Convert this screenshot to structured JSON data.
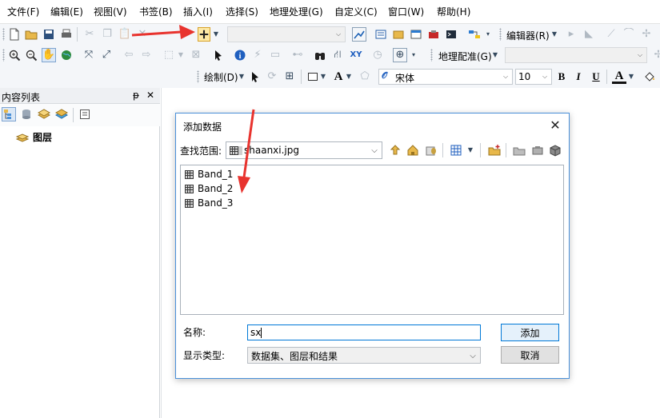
{
  "menu": [
    "文件(F)",
    "编辑(E)",
    "视图(V)",
    "书签(B)",
    "插入(I)",
    "选择(S)",
    "地理处理(G)",
    "自定义(C)",
    "窗口(W)",
    "帮助(H)"
  ],
  "toolbar": {
    "editor_label": "编辑器(R)",
    "georef_label": "地理配准(G)",
    "draw_label": "绘制(D)",
    "font_name": "宋体",
    "font_size": "10",
    "bold": "B",
    "italic": "I",
    "underline": "U",
    "font_color_glyph": "A",
    "text_glyph": "A"
  },
  "toc": {
    "title": "内容列表",
    "pin_glyph": "ᵽ",
    "close_glyph": "✕",
    "root_layer": "图层"
  },
  "dialog": {
    "title": "添加数据",
    "close_glyph": "✕",
    "lookin_label": "查找范围:",
    "lookin_value": "shaanxi.jpg",
    "files": [
      "Band_1",
      "Band_2",
      "Band_3"
    ],
    "name_label": "名称:",
    "name_value": "sx",
    "type_label": "显示类型:",
    "type_value": "数据集、图层和结果",
    "add_button": "添加",
    "cancel_button": "取消"
  },
  "colors": {
    "annotation_arrow": "#e8332e",
    "dialog_border": "#4a90d9",
    "focus_blue": "#0078d7"
  }
}
